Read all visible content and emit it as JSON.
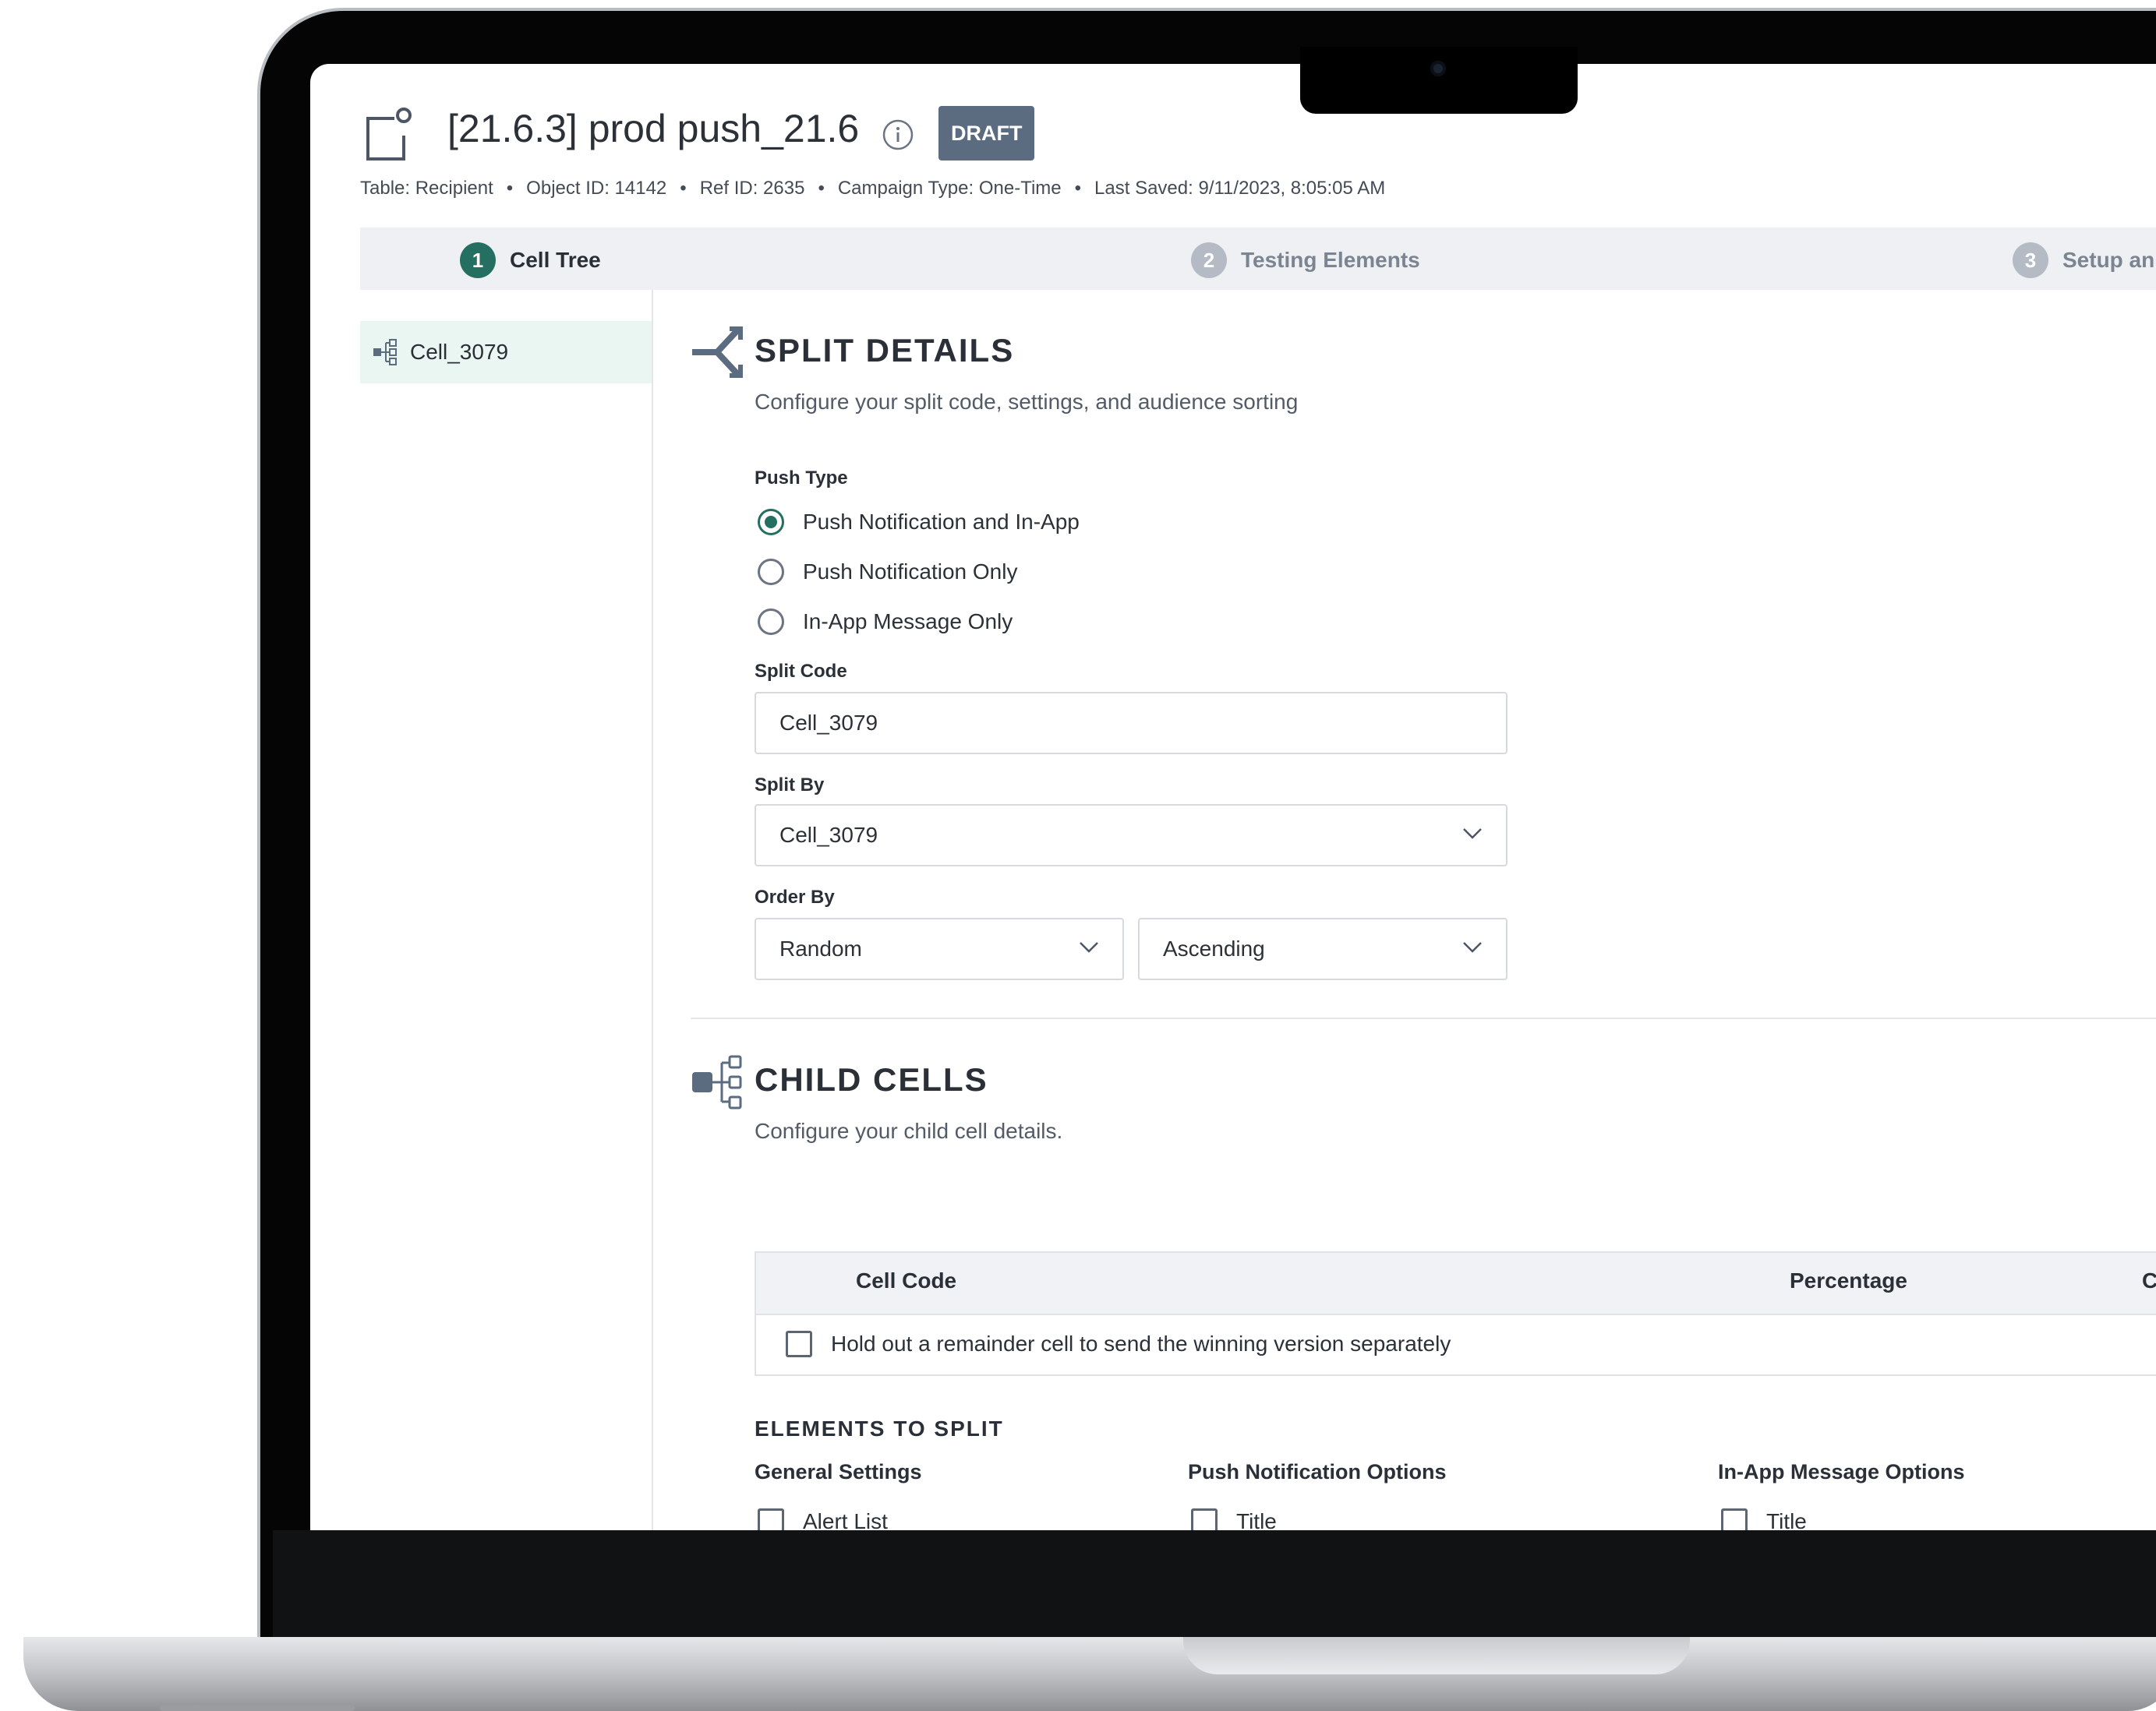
{
  "campaign": {
    "title": "[21.6.3] prod push_21.6",
    "status_badge": "DRAFT",
    "meta": {
      "table": "Table: Recipient",
      "object_id": "Object ID: 14142",
      "ref_id": "Ref ID: 2635",
      "campaign_type": "Campaign Type: One-Time",
      "last_saved": "Last Saved: 9/11/2023, 8:05:05 AM"
    }
  },
  "stepper": {
    "steps": [
      {
        "number": "1",
        "label": "Cell Tree",
        "state": "active"
      },
      {
        "number": "2",
        "label": "Testing Elements",
        "state": "inactive"
      },
      {
        "number": "3",
        "label": "Setup an",
        "state": "inactive"
      }
    ]
  },
  "sidebar": {
    "items": [
      {
        "label": "Cell_3079",
        "icon": "cell-tree-icon",
        "selected": true
      }
    ]
  },
  "split_details": {
    "title": "SPLIT DETAILS",
    "subtitle": "Configure your split code, settings, and audience sorting",
    "push_type": {
      "label": "Push Type",
      "options": [
        {
          "label": "Push Notification and In-App",
          "selected": true
        },
        {
          "label": "Push Notification Only",
          "selected": false
        },
        {
          "label": "In-App Message Only",
          "selected": false
        }
      ]
    },
    "split_code": {
      "label": "Split Code",
      "value": "Cell_3079"
    },
    "split_by": {
      "label": "Split By",
      "value": "Cell_3079"
    },
    "order_by": {
      "label": "Order By",
      "field": "Random",
      "direction": "Ascending"
    }
  },
  "child_cells": {
    "title": "CHILD CELLS",
    "subtitle": "Configure your child cell details.",
    "table": {
      "columns": [
        "Cell Code",
        "Percentage",
        "C"
      ],
      "holdout_label": "Hold out a remainder cell to send the winning version separately",
      "holdout_checked": false
    },
    "elements_to_split": {
      "title": "ELEMENTS TO SPLIT",
      "groups": [
        {
          "heading": "General Settings",
          "first_option": "Alert List"
        },
        {
          "heading": "Push Notification Options",
          "first_option": "Title"
        },
        {
          "heading": "In-App Message Options",
          "first_option": "Title"
        }
      ]
    }
  },
  "colors": {
    "accent": "#256f62",
    "badge": "#5b6b80",
    "selected_bg": "#eaf6f1",
    "stepper_bg": "#eff0f3"
  }
}
